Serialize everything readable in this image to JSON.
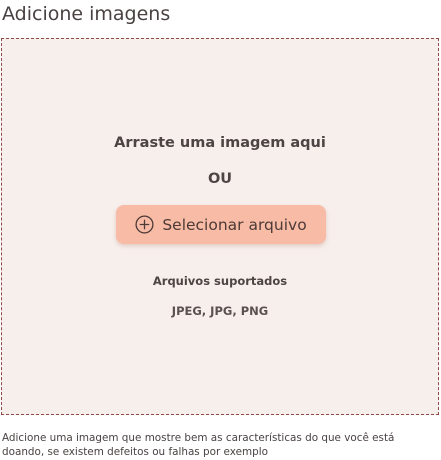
{
  "page": {
    "title": "Adicione imagens"
  },
  "dropzone": {
    "drag_text": "Arraste uma imagem aqui",
    "or_text": "OU",
    "select_button_label": "Selecionar arquivo",
    "select_button_icon": "plus-circle-icon",
    "supported_title": "Arquivos suportados",
    "supported_formats": "JPEG, JPG, PNG"
  },
  "helper": {
    "text": "Adicione uma imagem que mostre bem as características do que você está doando, se existem defeitos ou falhas por exemplo"
  },
  "colors": {
    "dropzone_bg": "#f7efec",
    "dropzone_border": "#8e4a44",
    "button_bg": "#f7bba6"
  }
}
